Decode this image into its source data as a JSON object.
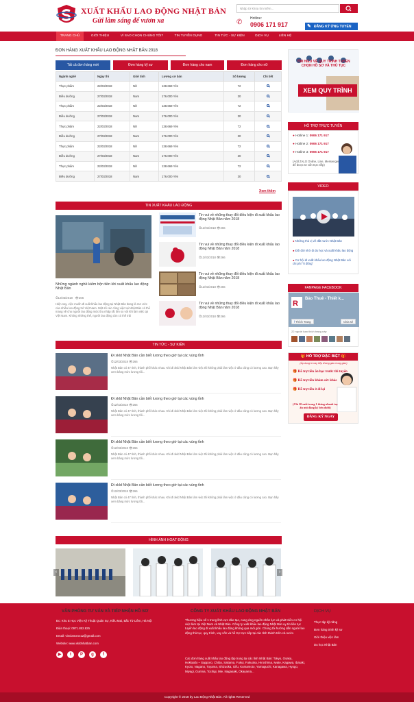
{
  "header": {
    "brand": "XUẤT KHẨU LAO ĐỘNG NHẬT BẢN",
    "slogan": "Gửi làm sáng để vươn xa",
    "search_placeholder": "Nhập từ khóa tìm kiếm...",
    "hotline_label": "Hotline:",
    "hotline_number": "0906 171 917",
    "register_label": "ĐĂNG KÝ ỨNG TUYỂN"
  },
  "nav": [
    "TRANG CHỦ",
    "GIỚI THIỆU",
    "VÌ SAO CHỌN CHÚNG TÔI?",
    "TIN TUYỂN DỤNG",
    "TIN TỨC - SỰ KIỆN",
    "DỊCH VỤ",
    "LIÊN HỆ"
  ],
  "orders": {
    "title": "ĐƠN HÀNG XUẤT KHẨU LAO ĐỘNG NHẬT BẢN 2018",
    "tabs": [
      "Tất cả đơn hàng mới",
      "Đơn hàng kỹ sư",
      "Đơn hàng cho nam",
      "Đơn hàng cho nữ"
    ],
    "columns": [
      "Ngành nghề",
      "Ngày thi",
      "Giới tính",
      "Lương cơ bản",
      "Số lượng",
      "Chi tiết"
    ],
    "rows": [
      [
        "Thực phẩm",
        "22/03/2018",
        "Nữ",
        "138.669 Yên",
        "72"
      ],
      [
        "Điều dưỡng",
        "27/03/2018",
        "Nam",
        "176.000 Yên",
        "30"
      ],
      [
        "Thực phẩm",
        "22/03/2018",
        "Nữ",
        "138.669 Yên",
        "72"
      ],
      [
        "Điều dưỡng",
        "27/03/2018",
        "Nam",
        "176.000 Yên",
        "30"
      ],
      [
        "Thực phẩm",
        "22/03/2018",
        "Nữ",
        "138.669 Yên",
        "72"
      ],
      [
        "Điều dưỡng",
        "27/03/2018",
        "Nam",
        "176.000 Yên",
        "30"
      ],
      [
        "Thực phẩm",
        "22/03/2018",
        "Nữ",
        "138.669 Yên",
        "72"
      ],
      [
        "Điều dưỡng",
        "27/03/2018",
        "Nam",
        "176.000 Yên",
        "30"
      ],
      [
        "Thực phẩm",
        "22/03/2018",
        "Nữ",
        "138.669 Yên",
        "72"
      ],
      [
        "Điều dưỡng",
        "27/03/2018",
        "Nam",
        "176.000 Yên",
        "30"
      ]
    ],
    "more": "Xem thêm"
  },
  "news": {
    "title": "TIN XUẤT KHẨU LAO ĐỘNG",
    "main_title": "Những ngành nghề kiếm bộn tiền khi xuất khẩu lao động Nhật Bản",
    "main_date": "12/03/2018",
    "main_views": "266",
    "main_desc": "Hiện nay, việc muốn đi xuất khẩu lao động tại Nhật Bản đang là mơ ước của nhiều lao động trẻ Việt Nam. Một số các công việc tại Nhật Bản có thể mang về cho người lao động mức thu nhập rất lớn so với khi làm việc tại Việt Nam. Không những thế, người lao động còn có thể trải",
    "items": [
      {
        "title": "Tin vui về những thay đổi điều kiện đi xuất khẩu lao động Nhật Bản năm 2018",
        "date": "12/03/2018",
        "views": "266"
      },
      {
        "title": "Tin vui về những thay đổi điều kiện đi xuất khẩu lao động Nhật Bản năm 2018",
        "date": "12/03/2018",
        "views": "266"
      },
      {
        "title": "Tin vui về những thay đổi điều kiện đi xuất khẩu lao động Nhật Bản năm 2018",
        "date": "12/03/2018",
        "views": "266"
      },
      {
        "title": "Tin vui về những thay đổi điều kiện đi xuất khẩu lao động Nhật Bản năm 2018",
        "date": "12/03/2018",
        "views": "266"
      }
    ]
  },
  "events": {
    "title": "TIN TỨC - SỰ KIỆN",
    "items": [
      {
        "title": "Đi xkld Nhật Bản cần biết lương theo giờ tại các vùng tỉnh",
        "date": "12/03/2018",
        "views": "266",
        "desc": "Nhật Bản có 47 tỉnh, thành phố khác nhau. Khi đi xkld Nhật Bản làm việc thì không phải làm việc ở đâu cũng có lương cao. Bạn hãy xem bảng mức lương tối..."
      },
      {
        "title": "Đi xkld Nhật Bản cần biết lương theo giờ tại các vùng tỉnh",
        "date": "12/03/2018",
        "views": "266",
        "desc": "Nhật Bản có 47 tỉnh, thành phố khác nhau. Khi đi xkld Nhật Bản làm việc thì không phải làm việc ở đâu cũng có lương cao. Bạn hãy xem bảng mức lương tối..."
      },
      {
        "title": "Đi xkld Nhật Bản cần biết lương theo giờ tại các vùng tỉnh",
        "date": "12/03/2018",
        "views": "266",
        "desc": "Nhật Bản có 47 tỉnh, thành phố khác nhau. Khi đi xkld Nhật Bản làm việc thì không phải làm việc ở đâu cũng có lương cao. Bạn hãy xem bảng mức lương tối..."
      },
      {
        "title": "Đi xkld Nhật Bản cần biết lương theo giờ tại các vùng tỉnh",
        "date": "12/03/2018",
        "views": "266",
        "desc": "Nhật Bản có 47 tỉnh, thành phố khác nhau. Khi đi xkld Nhật Bản làm việc thì không phải làm việc ở đâu cũng có lương cao. Bạn hãy xem bảng mức lương tối..."
      }
    ]
  },
  "gallery": {
    "title": "HÌNH ẢNH HOẠT ĐỘNG"
  },
  "sidebar": {
    "banner_top": "TÌM HIỂU VỀ QUY TRÌNH TUYỂN CHỌN HỒ SƠ VÀ THỦ TỤC",
    "banner_btn": "XEM QUY TRÌNH",
    "support_title": "HỖ TRỢ TRỰC TUYẾN",
    "hotlines": [
      {
        "label": "Hotline 1: ",
        "num": "0906 171 917"
      },
      {
        "label": "Hotline 2: ",
        "num": "0906 171 917"
      },
      {
        "label": "Hotline 3: ",
        "num": "0906 171 917"
      }
    ],
    "zalo": "(Add ZALO Online, Line, Messenger để được tư vấn trực tiếp)",
    "video_title": "VIDEO",
    "video_items": [
      "Những thủ vị về đất nước Nhật Bản",
      "Đổi đời nhờ đi du học và xuất khẩu lao động",
      "Cơ hội đi xuất khẩu lao động Nhật Bản với chi phí \"0 đồng\""
    ],
    "fanpage_title": "FANPAGE FACEBOOK",
    "fb_name": "Bảo Thuê - Thiết k...",
    "fb_like": "Thích Trang",
    "fb_share": "Chia sẻ",
    "fb_count": "22 người bạn thích trang này",
    "promo_title": "HỖ TRỢ ĐẶC BIỆT",
    "promo_sub": "(Áp dụng từ nay tiếp khóng giao trung gian)",
    "promo_lines": [
      "Hỗ trợ tiền ăn học trước thi tuyển",
      "Hỗ trợ tiền khám sức khỏe",
      "Hỗ trợ tiền ở đi lại"
    ],
    "promo_note": "(Chỉ 20 suất trong 1 tháng nhanh tay ấn nút đăng ký bên dưới)",
    "promo_btn": "ĐĂNG KÝ NGAY"
  },
  "footer": {
    "col1_title": "VĂN PHÒNG TƯ VẤN VÀ TIẾP NHẬN HỒ SƠ",
    "col1_lines": [
      "Đc: Khu E Học Viện Kỹ Thuật Quân Sự, Kiều Mai, Bắc Từ Liêm, Hà Nội",
      "Điện thoại: 0971.852.825",
      "Email: vieclamxnv12@gmail.com",
      "Website: www.xkldnhatban.com"
    ],
    "col2_title": "CÔNG TY XUẤT KHẨU LAO ĐỘNG NHẬT BẢN",
    "col2_p1": "Thương hiệu số 1 trong lĩnh vực đào tạo, cung ứng nguồn nhân lực và phát triển cơ hội việc làm tại Việt Nam và Nhật Bản. Công ty xuất khẩu lao động Nhật Bản uy tín liên tục tuyển lao động đi xuất khẩu lao động không qua môi giới. Chúng tôi hướng dẫn người lao động thủ tục, quy trình, vay vốn và hỗ trợ trực tiếp tại các tỉnh thành trên cả nước.",
    "col2_p2": "Các đơn hàng xuất khẩu lao động tập trung tại các tỉnh Nhật Bản: Tokyo, Osaka, Hokkaido – Sapporo, Chiba, Saitama, Fukui, Fukuoka, Hiroshima, Iwate, Kagawa, Ibaraki, Kyoto, Nagano, Toyama, Shizuoka, Gifu, Kumamoto, Yamaguchi, Kanagawa, Hyogo, Miyagi, Gunma, Tochigi, Mie, Nagasaki, Okayama...",
    "col3_title": "DỊCH VỤ",
    "col3_lines": [
      "Thực tập kỹ năng",
      "Đơn hàng trình kỹ sư",
      "Giới thiệu việc làm",
      "Du học Nhật Bản"
    ],
    "copyright": "Copyright © 2018 by Lao Động Nhật Bản. All rights Reserved"
  },
  "colors": {
    "brand": "#c8102e",
    "blue": "#2857a3"
  }
}
